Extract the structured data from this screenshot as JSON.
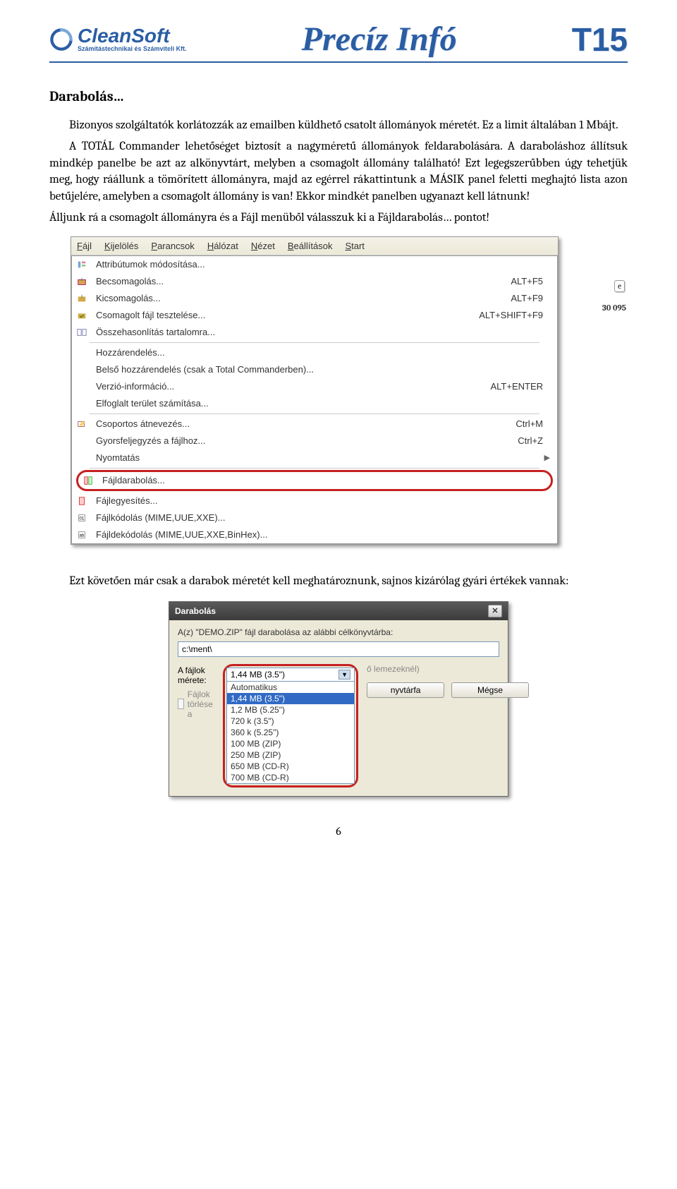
{
  "header": {
    "logo_main": "CleanSoft",
    "logo_sub": "Számítástechnikai és Számviteli Kft.",
    "title_center": "Precíz Infó",
    "title_right": "T15"
  },
  "text": {
    "heading": "Darabolás…",
    "p1": "Bizonyos szolgáltatók korlátozzák az emailben küldhető csatolt állományok méretét. Ez a limit általában 1 Mbájt.",
    "p2": "A TOTÁL Commander lehetőséget biztosít a nagyméretű állományok feldarabolására. A daraboláshoz állítsuk mindkép panelbe be azt az alkönyvtárt, melyben a csomagolt állomány található! Ezt legegszerűbben úgy tehetjük meg, hogy ráállunk a tömörített állományra, majd az egérrel rákattintunk a MÁSIK panel feletti meghajtó lista azon betűjelére, amelyben a csomagolt állomány is van! Ekkor mindkét panelben ugyanazt kell látnunk!",
    "p3": "Álljunk rá a csomagolt állományra és a Fájl menüből válasszuk ki a Fájldarabolás… pontot!",
    "p4": "Ezt követően már csak a darabok méretét kell meghatároznunk, sajnos kizárólag gyári értékek vannak:"
  },
  "menu": {
    "bar": [
      "Fájl",
      "Kijelölés",
      "Parancsok",
      "Hálózat",
      "Nézet",
      "Beállítások",
      "Start"
    ],
    "items": [
      {
        "label": "Attribútumok módosítása...",
        "shortcut": "",
        "icon": "attr"
      },
      {
        "label": "Becsomagolás...",
        "shortcut": "ALT+F5",
        "icon": "pack"
      },
      {
        "label": "Kicsomagolás...",
        "shortcut": "ALT+F9",
        "icon": "unpack"
      },
      {
        "label": "Csomagolt fájl tesztelése...",
        "shortcut": "ALT+SHIFT+F9",
        "icon": "test"
      },
      {
        "label": "Összehasonlítás tartalomra...",
        "shortcut": "",
        "icon": "compare"
      },
      {
        "label": "Hozzárendelés...",
        "shortcut": "",
        "icon": ""
      },
      {
        "label": "Belső hozzárendelés (csak a Total Commanderben)...",
        "shortcut": "",
        "icon": ""
      },
      {
        "label": "Verzió-információ...",
        "shortcut": "ALT+ENTER",
        "icon": ""
      },
      {
        "label": "Elfoglalt terület számítása...",
        "shortcut": "",
        "icon": ""
      },
      {
        "label": "Csoportos átnevezés...",
        "shortcut": "Ctrl+M",
        "icon": "rename"
      },
      {
        "label": "Gyorsfeljegyzés a fájlhoz...",
        "shortcut": "Ctrl+Z",
        "icon": ""
      },
      {
        "label": "Nyomtatás",
        "shortcut": "",
        "icon": "",
        "sub": true
      },
      {
        "label": "Fájldarabolás...",
        "shortcut": "",
        "icon": "split",
        "highlight": true
      },
      {
        "label": "Fájlegyesítés...",
        "shortcut": "",
        "icon": "merge"
      },
      {
        "label": "Fájlkódolás (MIME,UUE,XXE)...",
        "shortcut": "",
        "icon": "encode"
      },
      {
        "label": "Fájldekódolás (MIME,UUE,XXE,BinHex)...",
        "shortcut": "",
        "icon": "decode"
      }
    ],
    "side_chip": "e",
    "side_num": "30 095"
  },
  "dialog": {
    "title": "Darabolás",
    "line1": "A(z) \"DEMO.ZIP\" fájl darabolása az alábbi célkönyvtárba:",
    "path": "c:\\ment\\",
    "size_label": "A fájlok mérete:",
    "checkbox": "Fájlok törlése a",
    "checkbox_tail": "ő lemezeknél)",
    "combo_selected": "1,44 MB (3.5\")",
    "combo_options": [
      "Automatikus",
      "1,44 MB (3.5\")",
      "1,2 MB (5.25\")",
      "720 k (3.5\")",
      "360 k (5.25\")",
      "100 MB (ZIP)",
      "250 MB (ZIP)",
      "650 MB (CD-R)",
      "700 MB (CD-R)"
    ],
    "btn_dir": "nyvtárfa",
    "btn_cancel": "Mégse"
  },
  "pagenum": "6"
}
